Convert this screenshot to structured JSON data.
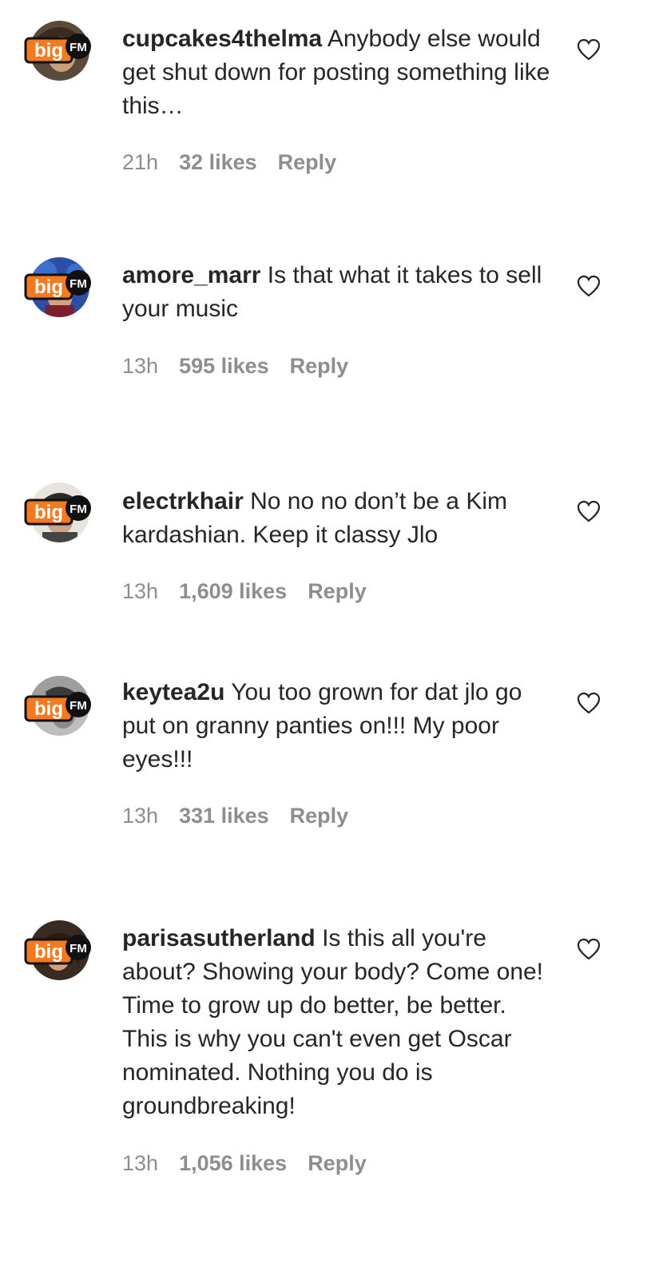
{
  "comments": [
    {
      "username": "cupcakes4thelma",
      "text": "Anybody else would get shut down for posting something like this…",
      "time": "21h",
      "likes": "32 likes",
      "reply": "Reply"
    },
    {
      "username": "amore_marr",
      "text": "Is that what it takes to sell your music",
      "time": "13h",
      "likes": "595 likes",
      "reply": "Reply"
    },
    {
      "username": "electrkhair",
      "text": "No no no don’t be a Kim kardashian. Keep it classy Jlo",
      "time": "13h",
      "likes": "1,609 likes",
      "reply": "Reply"
    },
    {
      "username": "keytea2u",
      "text": "You too grown for dat jlo go put on granny panties on!!! My poor eyes!!!",
      "time": "13h",
      "likes": "331 likes",
      "reply": "Reply"
    },
    {
      "username": "parisasutherland",
      "text": "Is this all you're about? Showing your body? Come one! Time to grow up do better, be better. This is why you can't even get Oscar nominated. Nothing you do is groundbreaking!",
      "time": "13h",
      "likes": "1,056 likes",
      "reply": "Reply"
    }
  ],
  "watermark": {
    "big": "big",
    "fm": "FM",
    "color": "#f47a1f"
  },
  "colors": {
    "text": "#262626",
    "meta": "#8e8e8e",
    "background": "#ffffff"
  }
}
